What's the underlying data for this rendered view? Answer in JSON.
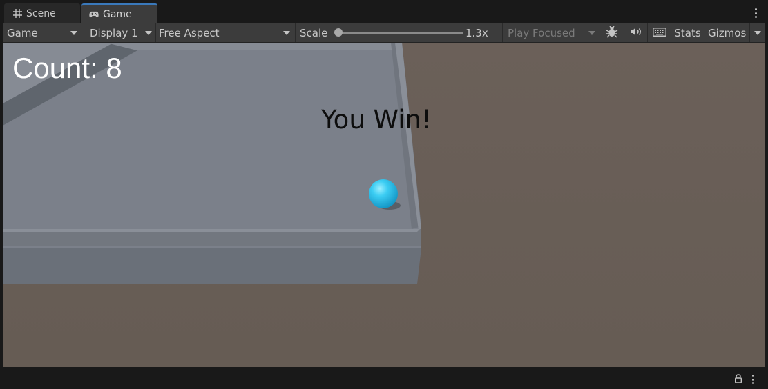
{
  "tabs": [
    {
      "label": "Scene",
      "icon": "grid-icon",
      "active": false
    },
    {
      "label": "Game",
      "icon": "gamepad-icon",
      "active": true
    }
  ],
  "toolbar": {
    "view_select": "Game",
    "display_select": "Display 1",
    "aspect_select": "Free Aspect",
    "scale_label": "Scale",
    "scale_value": "1.3x",
    "scale_fraction": 0.0,
    "play_mode_select": "Play Focused",
    "stats_label": "Stats",
    "gizmos_label": "Gizmos",
    "icons": [
      "bug-icon",
      "audio-mute-icon",
      "keyboard-icon",
      "chevron-down-icon"
    ]
  },
  "game_view": {
    "count_text": "Count: 8",
    "win_text": "You Win!",
    "colors": {
      "ground": "#665d56",
      "platform_top": "#7a7f88",
      "platform_front": "#6b717a",
      "player_ball": "#29c4ee"
    }
  },
  "statusbar": {
    "icons": [
      "lock-icon",
      "more-options-icon"
    ]
  }
}
